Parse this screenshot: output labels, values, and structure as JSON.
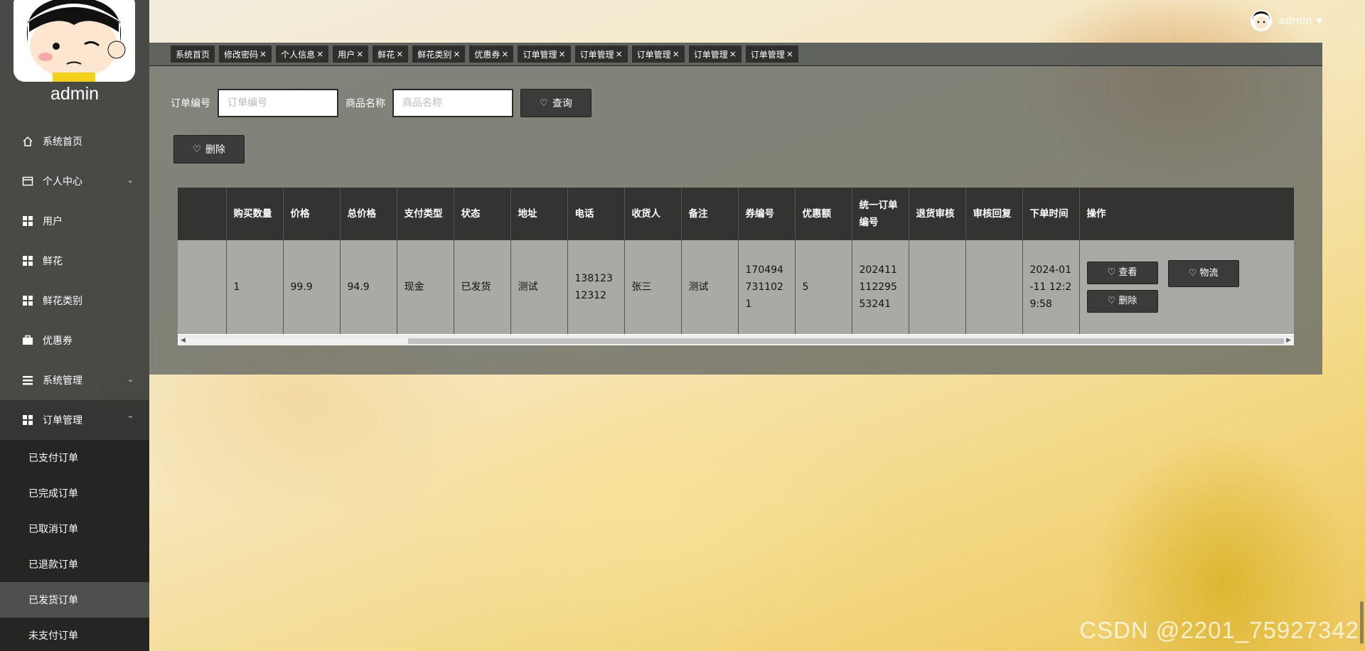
{
  "user": {
    "name": "admin"
  },
  "sidebar": {
    "username": "admin",
    "items": [
      {
        "label": "系统首页",
        "icon": "home-icon"
      },
      {
        "label": "个人中心",
        "icon": "card-icon",
        "chevron": "⌄"
      },
      {
        "label": "用户",
        "icon": "grid-icon"
      },
      {
        "label": "鲜花",
        "icon": "grid-icon"
      },
      {
        "label": "鲜花类别",
        "icon": "grid-icon"
      },
      {
        "label": "优惠券",
        "icon": "briefcase-icon"
      },
      {
        "label": "系统管理",
        "icon": "list-icon",
        "chevron": "⌄"
      },
      {
        "label": "订单管理",
        "icon": "grid-icon",
        "chevron": "⌃"
      }
    ],
    "submenu": [
      "已支付订单",
      "已完成订单",
      "已取消订单",
      "已退款订单",
      "已发货订单",
      "未支付订单"
    ]
  },
  "tabs": [
    "系统首页",
    "修改密码",
    "个人信息",
    "用户",
    "鲜花",
    "鲜花类别",
    "优惠券",
    "订单管理",
    "订单管理",
    "订单管理",
    "订单管理",
    "订单管理"
  ],
  "search": {
    "order_label": "订单编号",
    "order_placeholder": "订单编号",
    "product_label": "商品名称",
    "product_placeholder": "商品名称",
    "query_button": "查询"
  },
  "actions": {
    "delete_button": "删除"
  },
  "table": {
    "headers": [
      "",
      "购买数量",
      "价格",
      "总价格",
      "支付类型",
      "状态",
      "地址",
      "电话",
      "收货人",
      "备注",
      "券编号",
      "优惠额",
      "统一订单编号",
      "退货审核",
      "审核回复",
      "下单时间",
      "操作"
    ],
    "rows": [
      [
        "",
        "1",
        "99.9",
        "94.9",
        "现金",
        "已发货",
        "测试",
        "13812312312",
        "张三",
        "测试",
        "1704947311021",
        "5",
        "20241111229553241",
        "",
        "",
        "2024-01-11 12:29:58"
      ]
    ],
    "row_actions": {
      "view": "查看",
      "logistics": "物流",
      "delete": "删除"
    }
  },
  "watermark": "CSDN @2201_75927342",
  "colors": {
    "sidebar": "#3a3c3a",
    "button": "#3b3c39",
    "header": "#333431"
  }
}
